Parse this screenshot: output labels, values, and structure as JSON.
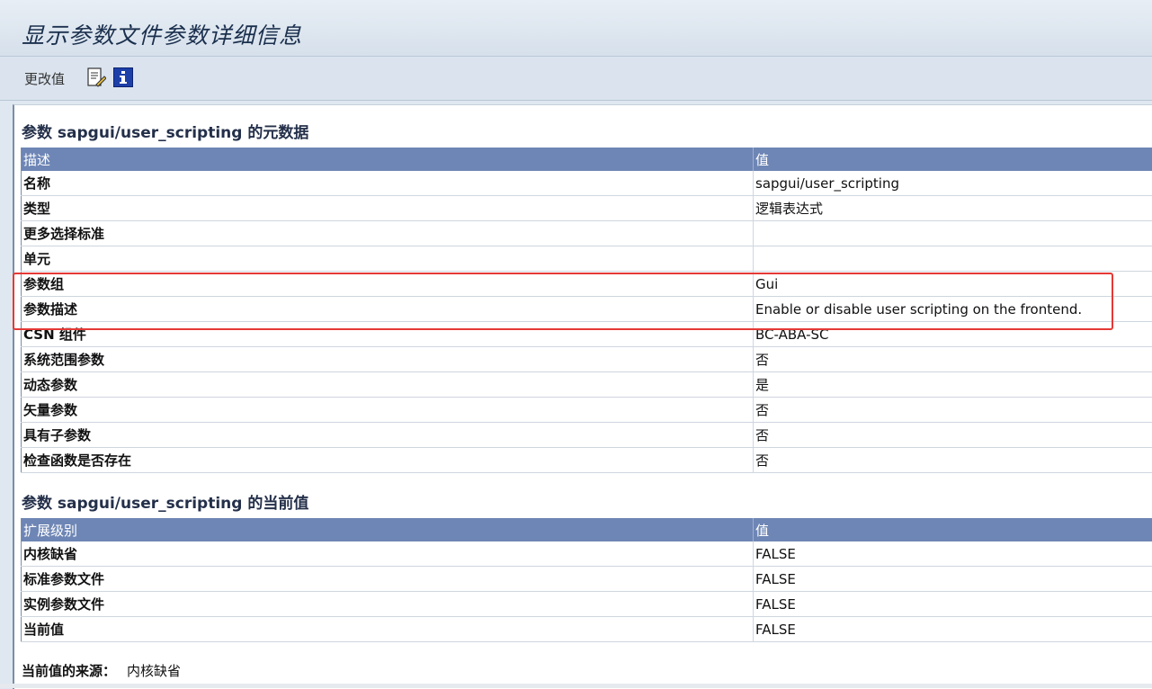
{
  "window": {
    "title": "显示参数文件参数详细信息"
  },
  "toolbar": {
    "change_value": "更改值",
    "icons": [
      "document-edit-icon",
      "info-icon"
    ]
  },
  "metadata": {
    "title": "参数 sapgui/user_scripting 的元数据",
    "headers": [
      "描述",
      "值"
    ],
    "rows": [
      {
        "label": "名称",
        "value": "sapgui/user_scripting"
      },
      {
        "label": "类型",
        "value": "逻辑表达式"
      },
      {
        "label": "更多选择标准",
        "value": ""
      },
      {
        "label": "单元",
        "value": ""
      },
      {
        "label": "参数组",
        "value": "Gui"
      },
      {
        "label": "参数描述",
        "value": "Enable or disable user scripting on the frontend."
      },
      {
        "label": "CSN 组件",
        "value": "BC-ABA-SC"
      },
      {
        "label": "系统范围参数",
        "value": "否"
      },
      {
        "label": "动态参数",
        "value": "是"
      },
      {
        "label": "矢量参数",
        "value": "否"
      },
      {
        "label": "具有子参数",
        "value": "否"
      },
      {
        "label": "检查函数是否存在",
        "value": "否"
      }
    ]
  },
  "current": {
    "title": "参数 sapgui/user_scripting 的当前值",
    "headers": [
      "扩展级别",
      "值"
    ],
    "rows": [
      {
        "label": "内核缺省",
        "value": "FALSE"
      },
      {
        "label": "标准参数文件",
        "value": "FALSE"
      },
      {
        "label": "实例参数文件",
        "value": "FALSE"
      },
      {
        "label": "当前值",
        "value": "FALSE"
      }
    ]
  },
  "source": {
    "label": "当前值的来源：",
    "value": "内核缺省"
  },
  "colors": {
    "header_bg": "#6e86b5",
    "highlight": "#e53935"
  }
}
